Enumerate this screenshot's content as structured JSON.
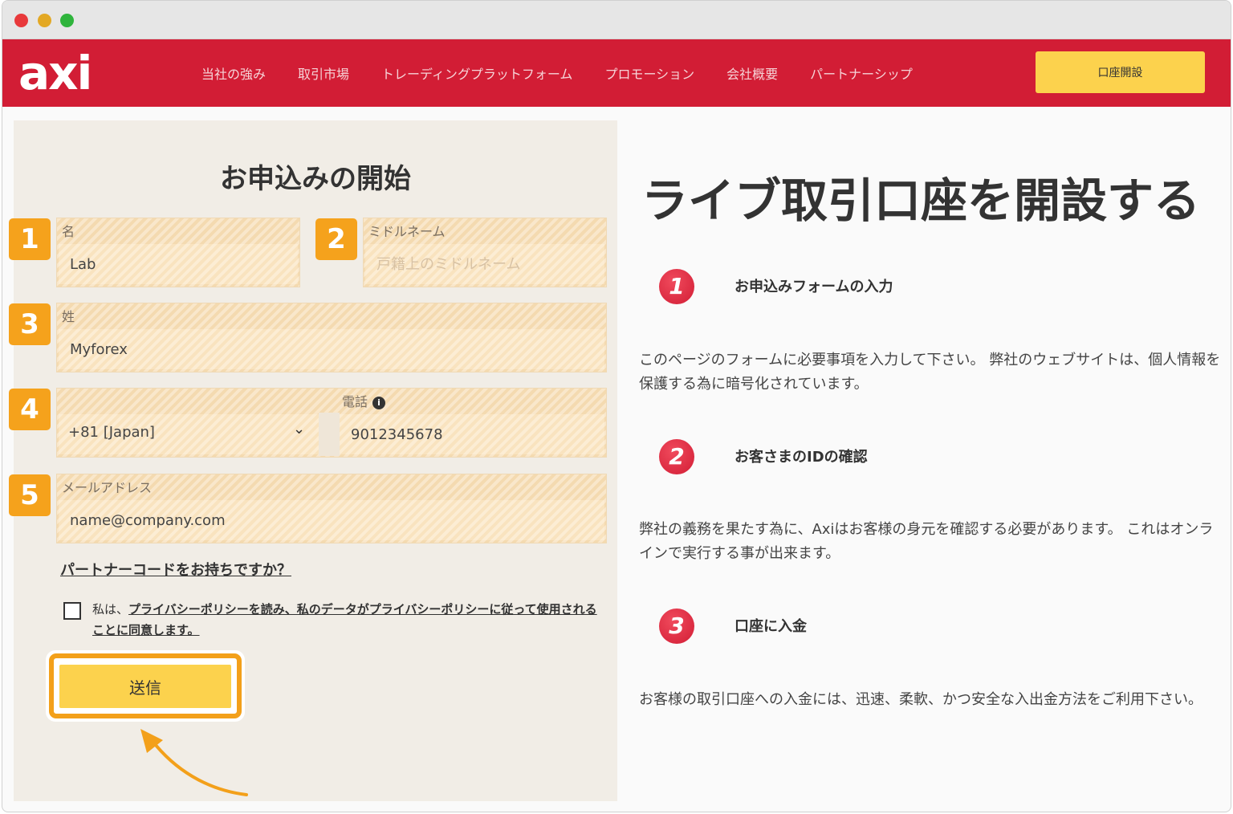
{
  "header": {
    "logo": "axi",
    "nav": [
      "当社の強み",
      "取引市場",
      "トレーディングプラットフォーム",
      "プロモーション",
      "会社概要",
      "パートナーシップ"
    ],
    "cta_label": "口座開設"
  },
  "form": {
    "title": "お申込みの開始",
    "steps": [
      "1",
      "2",
      "3",
      "4",
      "5"
    ],
    "first_name": {
      "label": "名",
      "value": "Lab"
    },
    "middle_name": {
      "label": "ミドルネーム",
      "placeholder": "戸籍上のミドルネーム",
      "value": ""
    },
    "last_name": {
      "label": "姓",
      "value": "Myforex"
    },
    "phone": {
      "label": "電話",
      "country_code": "+81 [Japan]",
      "value": "9012345678",
      "info_icon": "i"
    },
    "email": {
      "label": "メールアドレス",
      "value": "name@company.com"
    },
    "partner_code_link": "パートナーコードをお持ちですか？",
    "consent_prefix": "私は、",
    "consent_link": "プライバシーポリシーを読み、私のデータがプライバシーポリシーに従って使用されることに同意します。",
    "submit_label": "送信"
  },
  "info": {
    "title": "ライブ取引口座を開設する",
    "steps": [
      {
        "num": "1",
        "title": "お申込みフォームの入力",
        "desc": "このページのフォームに必要事項を入力して下さい。 弊社のウェブサイトは、個人情報を保護する為に暗号化されています。"
      },
      {
        "num": "2",
        "title": "お客さまのIDの確認",
        "desc": "弊社の義務を果たす為に、Axiはお客様の身元を確認する必要があります。 これはオンラインで実行する事が出来ます。"
      },
      {
        "num": "3",
        "title": "口座に入金",
        "desc": "お客様の取引口座への入金には、迅速、柔軟、かつ安全な入出金方法をご利用下さい。"
      }
    ]
  },
  "colors": {
    "brand_red": "#d21d35",
    "button_yellow": "#fcd24d",
    "highlight_orange": "#f5a21c"
  }
}
